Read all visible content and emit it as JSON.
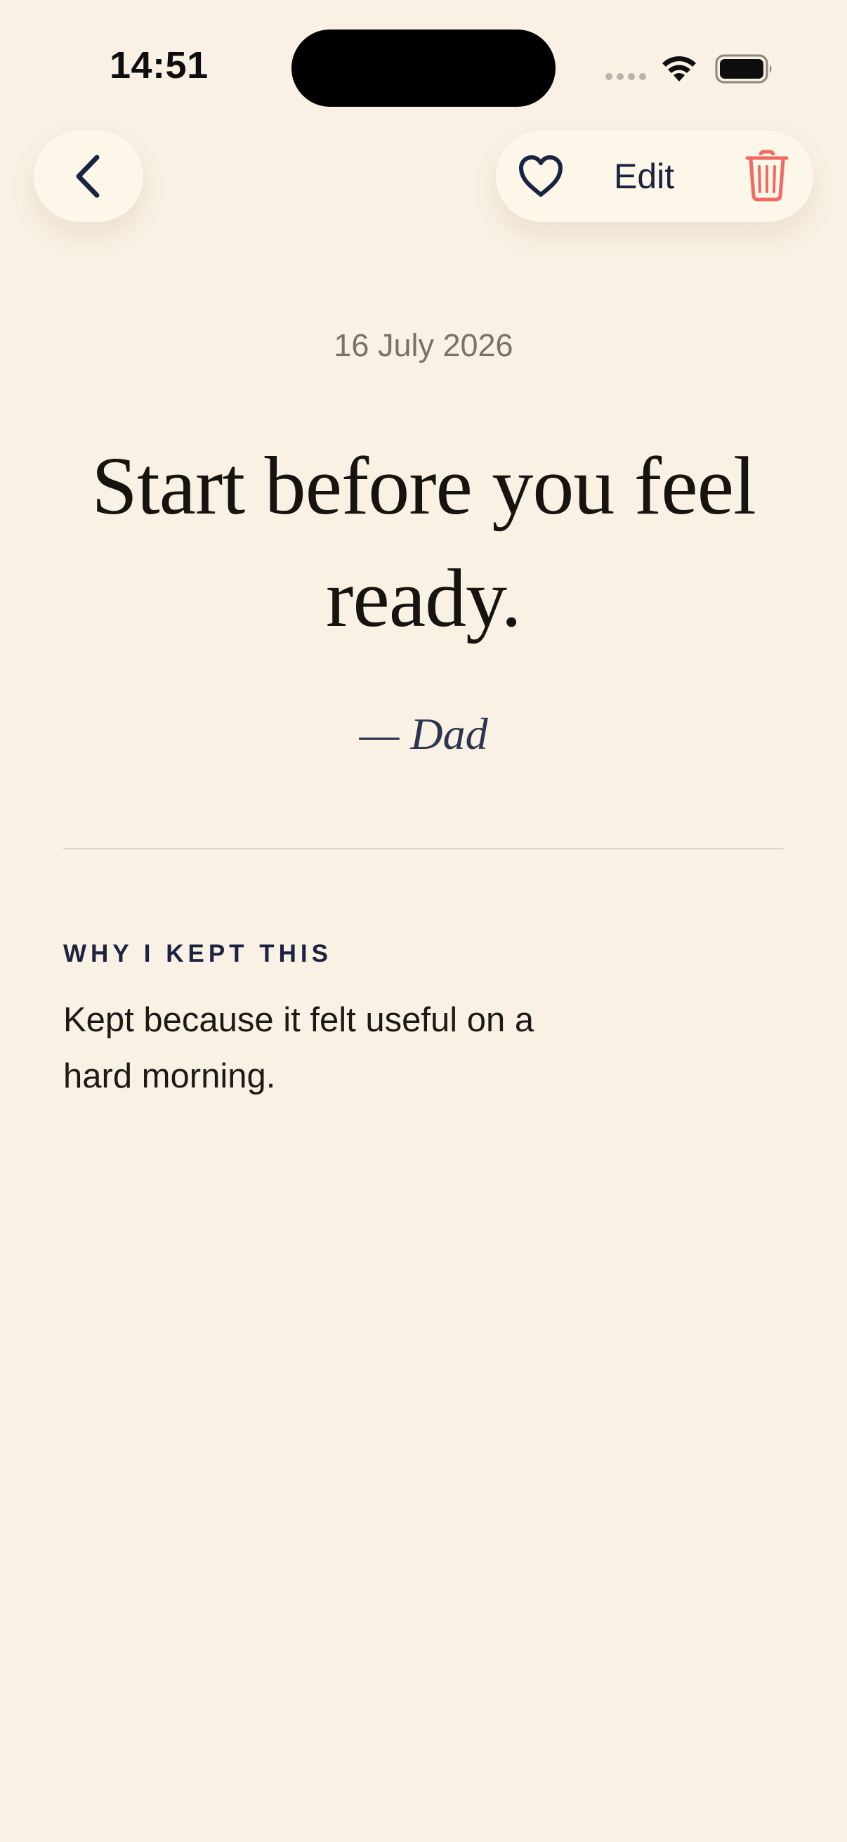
{
  "status_bar": {
    "time": "14:51"
  },
  "nav": {
    "back_icon": "chevron-left-icon",
    "favorite_icon": "heart-icon",
    "edit_label": "Edit",
    "delete_icon": "trash-icon"
  },
  "entry": {
    "date": "16 July 2026",
    "quote": "Start before you feel ready.",
    "author": "— Dad"
  },
  "note_section": {
    "heading": "WHY I KEPT THIS",
    "body": "Kept because it felt useful on a hard morning."
  },
  "colors": {
    "background": "#f9f1e4",
    "pill_background": "#fcf7e8",
    "navy": "#1b2340",
    "delete_red": "#f06a63",
    "muted_text": "#7a7265"
  }
}
